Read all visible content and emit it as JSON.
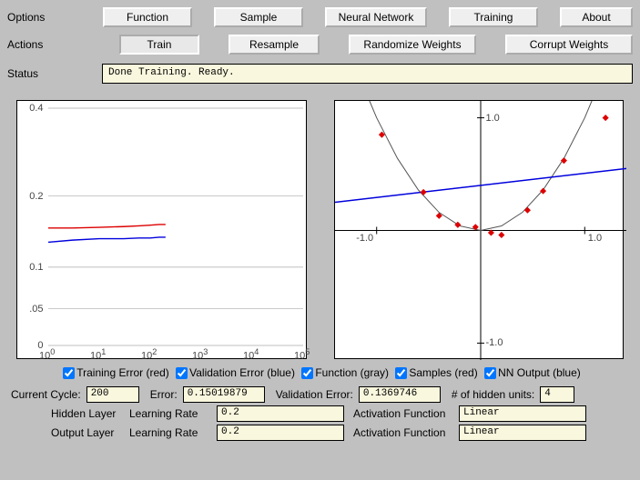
{
  "labels": {
    "options": "Options",
    "actions": "Actions",
    "status": "Status",
    "current_cycle": "Current Cycle:",
    "error": "Error:",
    "validation_error": "Validation Error:",
    "hidden_units": "# of hidden units:",
    "hidden_layer": "Hidden Layer",
    "output_layer": "Output Layer",
    "learning_rate": "Learning Rate",
    "activation_function": "Activation Function"
  },
  "options_buttons": {
    "function": "Function",
    "sample": "Sample",
    "neural_network": "Neural Network",
    "training": "Training",
    "about": "About"
  },
  "actions_buttons": {
    "train": "Train",
    "resample": "Resample",
    "randomize_weights": "Randomize Weights",
    "corrupt_weights": "Corrupt Weights"
  },
  "status_text": "Done Training. Ready.",
  "legend": {
    "training_error": "Training Error (red)",
    "validation_error": "Validation Error (blue)",
    "function": "Function (gray)",
    "samples": "Samples (red)",
    "nn_output": "NN Output (blue)"
  },
  "fields": {
    "current_cycle": "200",
    "error": "0.15019879",
    "validation_error": "0.1369746",
    "hidden_units": "4",
    "hidden_lr": "0.2",
    "output_lr": "0.2",
    "hidden_act": "Linear",
    "output_act": "Linear"
  },
  "chart_data": [
    {
      "type": "line",
      "title": "",
      "xlabel": "",
      "ylabel": "",
      "x_scale": "log",
      "x_ticks": [
        "10⁰",
        "10¹",
        "10²",
        "10³",
        "10⁴",
        "10⁵"
      ],
      "y_ticks": [
        0,
        0.05,
        0.1,
        0.2,
        0.4
      ],
      "ylim": [
        0,
        0.4
      ],
      "series": [
        {
          "name": "Training Error",
          "color": "#d00",
          "x": [
            1,
            3,
            10,
            30,
            60,
            100,
            150,
            200
          ],
          "values": [
            0.155,
            0.155,
            0.156,
            0.157,
            0.158,
            0.159,
            0.16,
            0.16
          ]
        },
        {
          "name": "Validation Error",
          "color": "#00d",
          "x": [
            1,
            3,
            10,
            30,
            60,
            100,
            150,
            200
          ],
          "values": [
            0.135,
            0.138,
            0.14,
            0.14,
            0.141,
            0.141,
            0.142,
            0.142
          ]
        }
      ]
    },
    {
      "type": "scatter+line",
      "xlim": [
        -1.4,
        1.4
      ],
      "ylim": [
        -1.15,
        1.15
      ],
      "x_ticks": [
        -1.0,
        1.0
      ],
      "y_ticks": [
        -1.0,
        1.0
      ],
      "series": [
        {
          "name": "Function",
          "type": "line",
          "color": "#555",
          "x": [
            -1.2,
            -1.0,
            -0.8,
            -0.6,
            -0.4,
            -0.2,
            0,
            0.2,
            0.4,
            0.6,
            0.8,
            1.0,
            1.2
          ],
          "values": [
            1.44,
            1.0,
            0.64,
            0.36,
            0.16,
            0.04,
            0.0,
            0.04,
            0.16,
            0.36,
            0.64,
            1.0,
            1.44
          ]
        },
        {
          "name": "NN Output",
          "type": "line",
          "color": "#00d",
          "x": [
            -1.4,
            1.4
          ],
          "values": [
            0.25,
            0.55
          ]
        },
        {
          "name": "Samples",
          "type": "scatter",
          "color": "#d00",
          "x": [
            -0.95,
            -0.55,
            -0.4,
            -0.22,
            -0.05,
            0.1,
            0.2,
            0.45,
            0.6,
            0.8,
            1.2
          ],
          "values": [
            0.85,
            0.34,
            0.13,
            0.05,
            0.03,
            -0.02,
            -0.04,
            0.18,
            0.35,
            0.62,
            1.0
          ]
        }
      ]
    }
  ]
}
